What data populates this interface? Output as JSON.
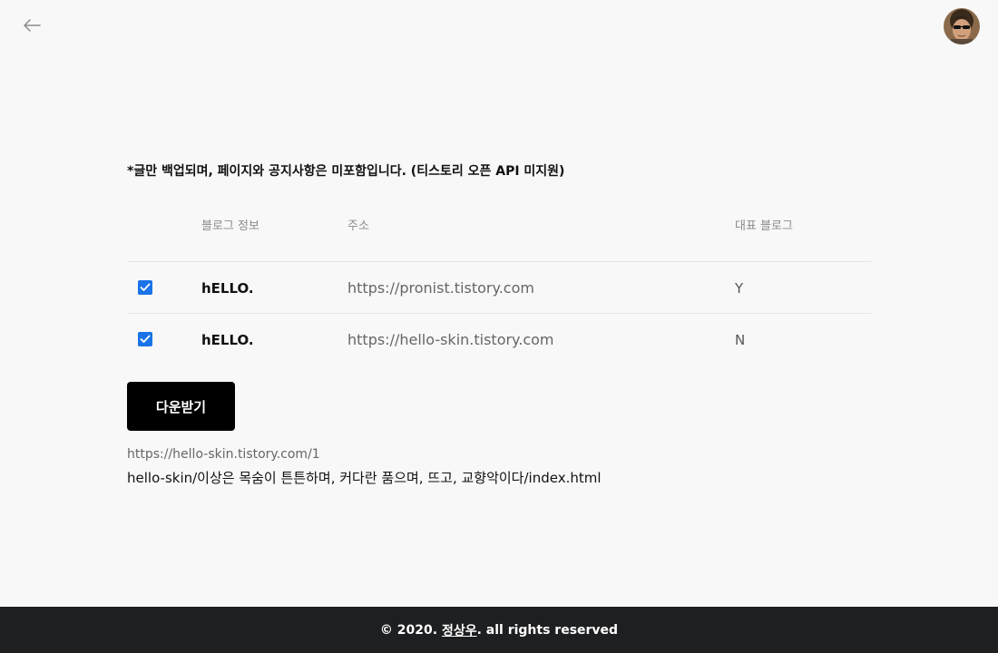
{
  "header": {
    "back_icon": "arrow-left-icon",
    "avatar_icon": "user-avatar"
  },
  "notice": "*글만 백업되며, 페이지와 공지사항은 미포함입니다. (티스토리 오픈 API 미지원)",
  "table": {
    "columns": [
      "블로그 정보",
      "주소",
      "대표 블로그"
    ],
    "rows": [
      {
        "checked": true,
        "name": "hELLO.",
        "url": "https://pronist.tistory.com",
        "main": "Y"
      },
      {
        "checked": true,
        "name": "hELLO.",
        "url": "https://hello-skin.tistory.com",
        "main": "N"
      }
    ]
  },
  "download_label": "다운받기",
  "progress": {
    "url": "https://hello-skin.tistory.com/1",
    "path": "hello-skin/이상은 목숨이 튼튼하며, 커다란 품으며, 뜨고, 교향악이다/index.html"
  },
  "footer": {
    "prefix": "© 2020.",
    "author": "정상우",
    "suffix": ". all rights reserved"
  },
  "colors": {
    "background": "#f8f8f8",
    "checkbox": "#1a73e8",
    "button": "#000000",
    "footer": "#1e1f21"
  }
}
